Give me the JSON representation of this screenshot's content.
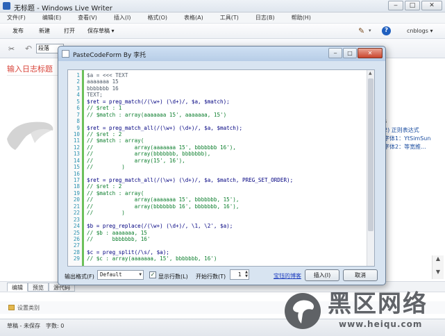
{
  "window": {
    "title": "无标题 - Windows Live Writer",
    "minimize": "‒",
    "maximize": "□",
    "close": "✕"
  },
  "menu": [
    "文件(F)",
    "编辑(E)",
    "查看(V)",
    "插入(I)",
    "格式(O)",
    "表格(A)",
    "工具(T)",
    "日志(B)",
    "帮助(H)"
  ],
  "toolbar": {
    "publish": "发布",
    "new": "新建",
    "open": "打开",
    "save_draft": "保存草稿 ▾",
    "blog_name": "cnblogs ▾"
  },
  "format_toolbar": {
    "style": "段落"
  },
  "editor": {
    "title_placeholder": "输入日志标题"
  },
  "right_pane": {
    "lines": [
      "s",
      "2) 正则表达式",
      "字体1：YtSimSun",
      "字体2：等宽推..."
    ]
  },
  "view_tabs": [
    "编辑",
    "预览",
    "源代码"
  ],
  "category": {
    "label": "设置类别"
  },
  "status": {
    "state": "草稿 - 未保存",
    "word_count": "字数: 0"
  },
  "watermark": {
    "brand": "黑区网络",
    "url": "www.heiqu.com"
  },
  "dialog": {
    "title": "PasteCodeForm By 李托",
    "close": "✕",
    "code_lines": [
      "$a = <<< TEXT",
      "aaaaaaa 15",
      "bbbbbbb 16",
      "TEXT;",
      "$ret = preg_match(/(\\w+) (\\d+)/, $a, $match);",
      "// $ret : 1",
      "// $match : array(aaaaaaa 15', aaaaaaa, 15')",
      "",
      "$ret = preg_match_all(/(\\w+) (\\d+)/, $a, $match);",
      "// $ret : 2",
      "// $match : array(",
      "//             array(aaaaaaa 15', bbbbbbb 16'),",
      "//             array(bbbbbbb, bbbbbbb),",
      "//             array(15', 16'),",
      "//         )",
      "",
      "$ret = preg_match_all(/(\\w+) (\\d+)/, $a, $match, PREG_SET_ORDER);",
      "// $ret : 2",
      "// $match : array(",
      "//             array(aaaaaaa 15', bbbbbbb, 15'),",
      "//             array(bbbbbbb 16', bbbbbbb, 16'),",
      "//         )",
      "",
      "$b = preg_replace(/(\\w+) (\\d+)/, \\1, \\2', $a);",
      "// $b : aaaaaaa, 15",
      "//      bbbbbbb, 16'",
      "",
      "$c = preg_split(/\\s/, $a);",
      "// $c : array(aaaaaaa, 15', bbbbbbb, 16')"
    ],
    "output_format_label": "输出格式(F)",
    "output_format_value": "Default",
    "show_line_numbers_label": "显示行数(L)",
    "show_line_numbers_checked": true,
    "start_line_label": "开始行数(T)",
    "start_line_value": "1",
    "link_text": "宝钰的博客",
    "insert_button": "插入(I)",
    "cancel_button": "取消"
  }
}
